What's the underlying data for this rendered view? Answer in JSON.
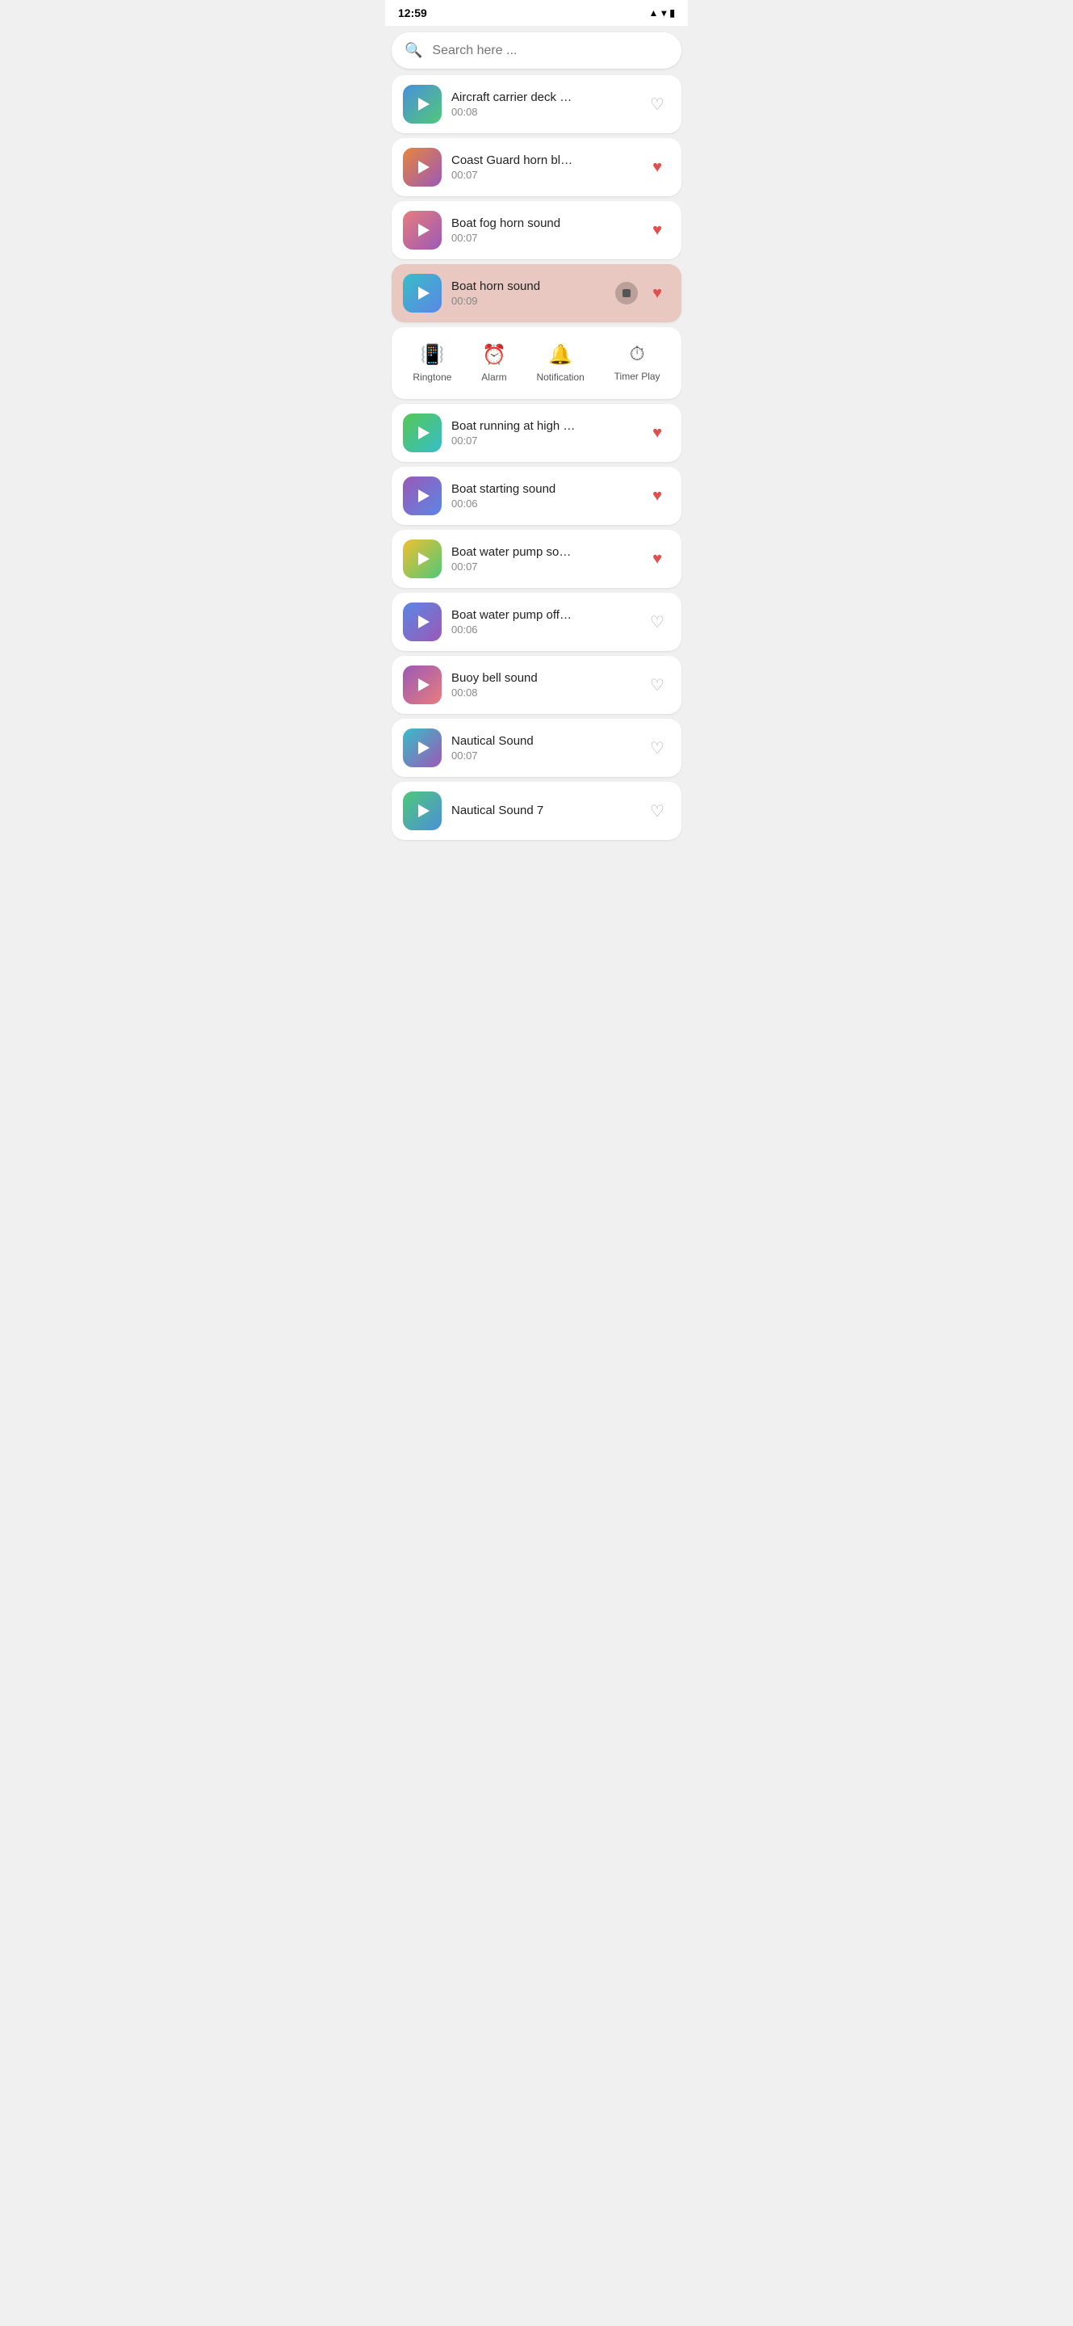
{
  "statusBar": {
    "time": "12:59",
    "icons": [
      "signal",
      "wifi",
      "battery"
    ]
  },
  "search": {
    "placeholder": "Search here ..."
  },
  "sounds": [
    {
      "id": 1,
      "title": "Aircraft carrier deck …",
      "duration": "00:08",
      "bgClass": "bg-blue-green",
      "favorited": false,
      "active": false
    },
    {
      "id": 2,
      "title": "Coast Guard horn bl…",
      "duration": "00:07",
      "bgClass": "bg-orange-purple",
      "favorited": true,
      "active": false
    },
    {
      "id": 3,
      "title": "Boat fog horn sound",
      "duration": "00:07",
      "bgClass": "bg-pink-purple",
      "favorited": true,
      "active": false
    },
    {
      "id": 4,
      "title": "Boat horn sound",
      "duration": "00:09",
      "bgClass": "bg-teal-blue",
      "favorited": true,
      "active": true
    },
    {
      "id": 5,
      "title": "Boat running at high …",
      "duration": "00:07",
      "bgClass": "bg-green-teal",
      "favorited": true,
      "active": false
    },
    {
      "id": 6,
      "title": "Boat starting sound",
      "duration": "00:06",
      "bgClass": "bg-purple-blue",
      "favorited": true,
      "active": false
    },
    {
      "id": 7,
      "title": "Boat water pump so…",
      "duration": "00:07",
      "bgClass": "bg-yellow-green",
      "favorited": true,
      "active": false
    },
    {
      "id": 8,
      "title": "Boat water pump off…",
      "duration": "00:06",
      "bgClass": "bg-blue-purple",
      "favorited": false,
      "active": false
    },
    {
      "id": 9,
      "title": "Buoy bell sound",
      "duration": "00:08",
      "bgClass": "bg-purple-pink",
      "favorited": false,
      "active": false
    },
    {
      "id": 10,
      "title": "Nautical Sound",
      "duration": "00:07",
      "bgClass": "bg-teal-purple",
      "favorited": false,
      "active": false
    },
    {
      "id": 11,
      "title": "Nautical Sound 7",
      "duration": "",
      "bgClass": "bg-green-blue",
      "favorited": false,
      "active": false
    }
  ],
  "actionPanel": {
    "buttons": [
      {
        "id": "ringtone",
        "label": "Ringtone",
        "icon": "📳"
      },
      {
        "id": "alarm",
        "label": "Alarm",
        "icon": "⏰"
      },
      {
        "id": "notification",
        "label": "Notification",
        "icon": "🔔"
      },
      {
        "id": "timer",
        "label": "Timer Play",
        "icon": "⏱"
      }
    ]
  }
}
